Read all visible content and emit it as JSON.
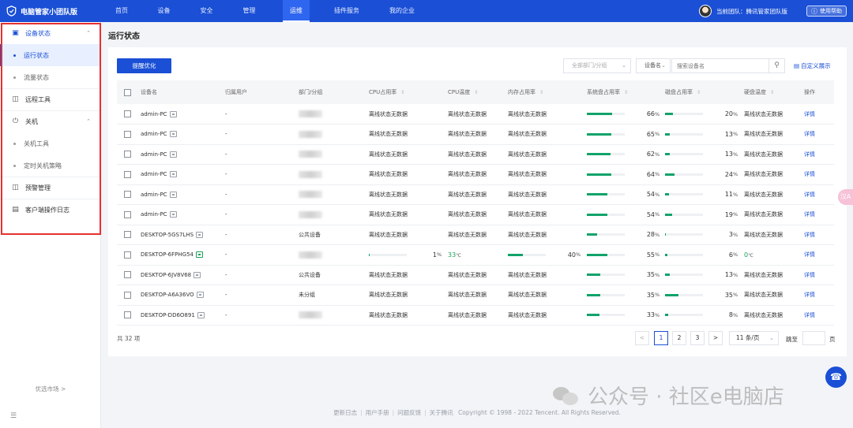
{
  "app": {
    "title": "电脑管家小团队版"
  },
  "nav": [
    "首页",
    "设备",
    "安全",
    "管理",
    "运维",
    "插件服务",
    "我的企业"
  ],
  "header": {
    "team": "当前团队：腾讯管家团队版",
    "help": "使用帮助"
  },
  "sidebar": {
    "g1": "设备状态",
    "g1_sub1": "运行状态",
    "g1_sub2": "流量状态",
    "g2": "远程工具",
    "g3": "关机",
    "g3_sub1": "关机工具",
    "g3_sub2": "定时关机策略",
    "g4": "预警管理",
    "g5": "客户端操作日志",
    "market": "优选市场 >"
  },
  "page": {
    "title": "运行状态"
  },
  "toolbar": {
    "optimize": "提醒优化",
    "dept_select": "全部部门/分组",
    "field_select": "设备名",
    "search_placeholder": "搜索设备名",
    "custom": "自定义展示"
  },
  "table": {
    "headers": [
      "设备名",
      "归属用户",
      "部门/分组",
      "CPU占用率",
      "CPU温度",
      "内存占用率",
      "系统盘占用率",
      "磁盘占用率",
      "硬盘温度",
      "操作"
    ],
    "rows": [
      {
        "name": "admin-PC",
        "user": "-",
        "dept": "",
        "cpu": "离线状态无数据",
        "cpu_temp": "离线状态无数据",
        "mem": "离线状态无数据",
        "sys": 66,
        "disk": 20,
        "hd_temp": "离线状态无数据",
        "op": "详情"
      },
      {
        "name": "admin-PC",
        "user": "-",
        "dept": "",
        "cpu": "离线状态无数据",
        "cpu_temp": "离线状态无数据",
        "mem": "离线状态无数据",
        "sys": 65,
        "disk": 13,
        "hd_temp": "离线状态无数据",
        "op": "详情"
      },
      {
        "name": "admin-PC",
        "user": "-",
        "dept": "",
        "cpu": "离线状态无数据",
        "cpu_temp": "离线状态无数据",
        "mem": "离线状态无数据",
        "sys": 62,
        "disk": 13,
        "hd_temp": "离线状态无数据",
        "op": "详情"
      },
      {
        "name": "admin-PC",
        "user": "-",
        "dept": "",
        "cpu": "离线状态无数据",
        "cpu_temp": "离线状态无数据",
        "mem": "离线状态无数据",
        "sys": 64,
        "disk": 24,
        "hd_temp": "离线状态无数据",
        "op": "详情"
      },
      {
        "name": "admin-PC",
        "user": "-",
        "dept": "",
        "cpu": "离线状态无数据",
        "cpu_temp": "离线状态无数据",
        "mem": "离线状态无数据",
        "sys": 54,
        "disk": 11,
        "hd_temp": "离线状态无数据",
        "op": "详情"
      },
      {
        "name": "admin-PC",
        "user": "-",
        "dept": "",
        "cpu": "离线状态无数据",
        "cpu_temp": "离线状态无数据",
        "mem": "离线状态无数据",
        "sys": 54,
        "disk": 19,
        "hd_temp": "离线状态无数据",
        "op": "详情"
      },
      {
        "name": "DESKTOP-5GS7LHS",
        "user": "-",
        "dept": "公共设备",
        "cpu": "离线状态无数据",
        "cpu_temp": "离线状态无数据",
        "mem": "离线状态无数据",
        "sys": 28,
        "disk": 3,
        "hd_temp": "离线状态无数据",
        "op": "详情"
      },
      {
        "name": "DESKTOP-6FPHG54",
        "user": "-",
        "dept": "",
        "cpu": 1,
        "cpu_temp": "33",
        "mem": 40,
        "sys": 55,
        "disk": 6,
        "hd_temp": "0",
        "op": "详情",
        "online": true
      },
      {
        "name": "DESKTOP-6JV8V68",
        "user": "-",
        "dept": "公共设备",
        "cpu": "离线状态无数据",
        "cpu_temp": "离线状态无数据",
        "mem": "离线状态无数据",
        "sys": 35,
        "disk": 13,
        "hd_temp": "离线状态无数据",
        "op": "详情"
      },
      {
        "name": "DESKTOP-A6A36VO",
        "user": "-",
        "dept": "未分组",
        "cpu": "离线状态无数据",
        "cpu_temp": "离线状态无数据",
        "mem": "离线状态无数据",
        "sys": 35,
        "disk": 35,
        "hd_temp": "离线状态无数据",
        "op": "详情"
      },
      {
        "name": "DESKTOP-DD6O891",
        "user": "-",
        "dept": "",
        "cpu": "离线状态无数据",
        "cpu_temp": "离线状态无数据",
        "mem": "离线状态无数据",
        "sys": 33,
        "disk": 8,
        "hd_temp": "离线状态无数据",
        "op": "详情"
      }
    ]
  },
  "pagination": {
    "total": "共 32 项",
    "prev": "<",
    "p1": "1",
    "p2": "2",
    "p3": "3",
    "next": ">",
    "size": "11 条/页",
    "jump": "跳至",
    "page": "页"
  },
  "footer": {
    "l1": "更新日志",
    "l2": "用户手册",
    "l3": "问题反馈",
    "l4": "关于腾讯",
    "copyright": "Copyright © 1998 - 2022 Tencent. All Rights Reserved."
  },
  "watermark": "公众号 · 社区e电脑店",
  "float_tab": "汉A",
  "colors": {
    "primary": "#1a4fd6",
    "bar": "#11a36a",
    "online": "#19a05a",
    "highlight": "#e5312f"
  },
  "icons": [
    "shield-logo-icon",
    "help-circle-icon",
    "monitor-icon",
    "remote-screen-icon",
    "power-icon",
    "alert-icon",
    "log-icon",
    "search-icon",
    "list-icon",
    "headset-icon",
    "sort-icon",
    "device-icon"
  ]
}
